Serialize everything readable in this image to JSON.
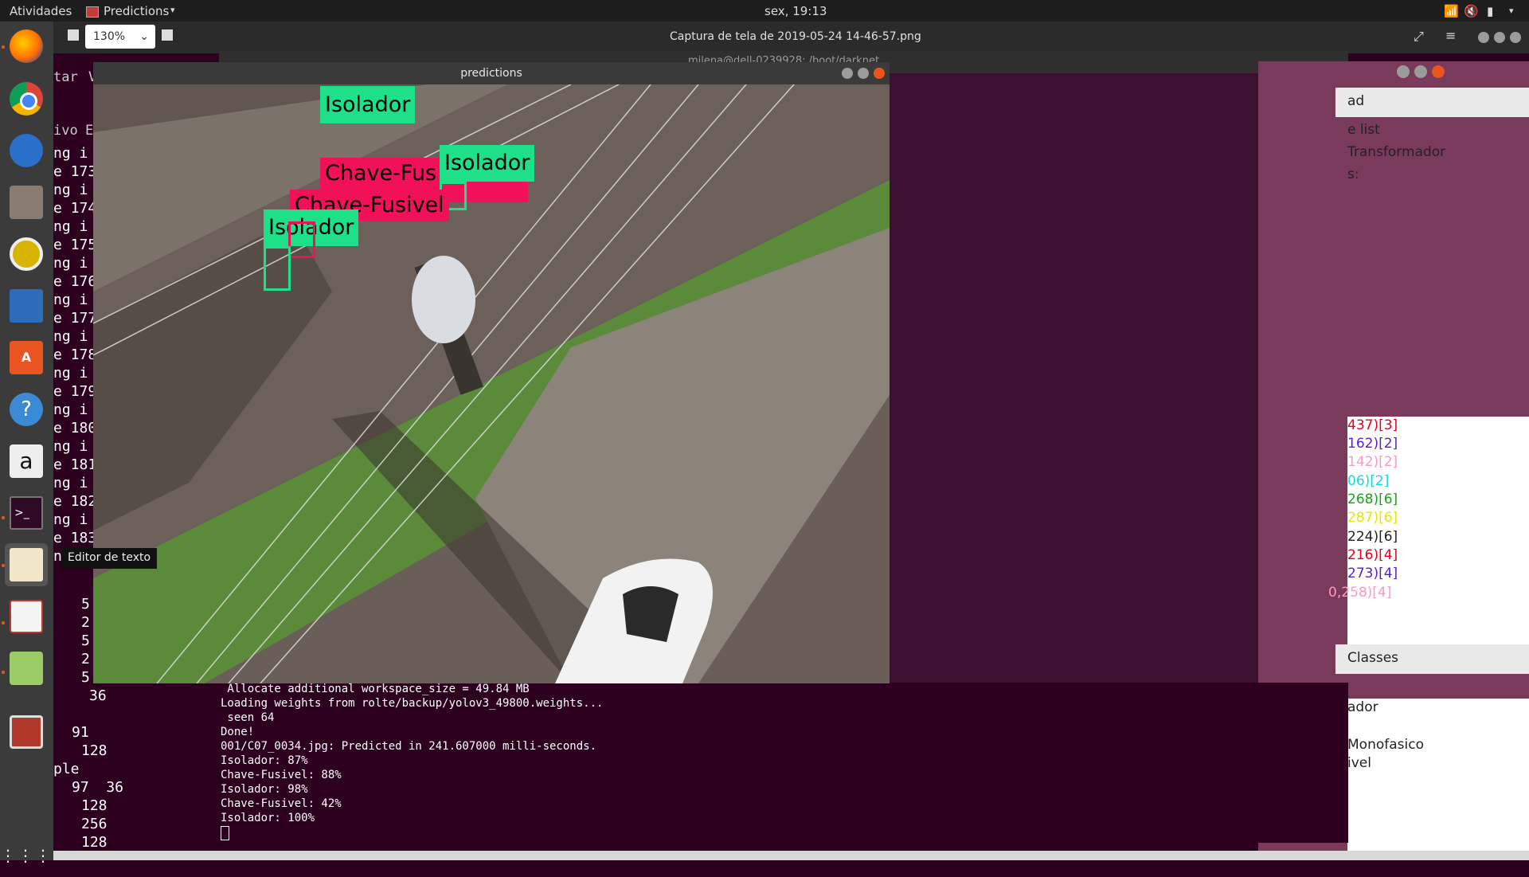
{
  "topbar": {
    "activities": "Atividades",
    "app_menu": "Predictions",
    "clock": "sex, 19:13"
  },
  "viewer": {
    "zoom": "130%",
    "title": "Captura de tela de 2019-05-24 14-46-57.png"
  },
  "background_window": {
    "title": "milena@dell-0239928: /boot/darknet",
    "left_menu_partial": [
      "tar",
      "V",
      "ivo",
      "E"
    ]
  },
  "left_terminal": {
    "lines": [
      "ng i",
      "e 173",
      "ng i",
      "e 174",
      "ng i",
      "e 175",
      "ng i",
      "e 176",
      "ng i",
      "e 177",
      "ng i",
      "e 178",
      "ng i",
      "e 179",
      "ng i",
      "e 180",
      "ng i",
      "e 181",
      "ng i",
      "e 182",
      "ng i",
      "e 183",
      "ng"
    ],
    "numbers": [
      "5",
      "2",
      "5",
      "2",
      "5",
      "36",
      "91",
      "128",
      "ple",
      "97  36",
      "128",
      "256",
      "128"
    ]
  },
  "right_panel": {
    "header": "ad",
    "texts": [
      "e list",
      "Transformador",
      "s:"
    ],
    "classes_header": "Classes",
    "class_items": [
      "ador",
      "Monofasico",
      "ivel"
    ],
    "colored_items": [
      {
        "text": "437)[3]",
        "color": "#e3001b"
      },
      {
        "text": "162)[2]",
        "color": "#5a1cd6"
      },
      {
        "text": "142)[2]",
        "color": "#ff9ab8"
      },
      {
        "text": "06)[2]",
        "color": "#15d6e0"
      },
      {
        "text": "268)[6]",
        "color": "#1aa31a"
      },
      {
        "text": "287)[6]",
        "color": "#e6e600"
      },
      {
        "text": "224)[6]",
        "color": "#222222"
      },
      {
        "text": "216)[4]",
        "color": "#e3001b"
      },
      {
        "text": "273)[4]",
        "color": "#5a1cd6"
      },
      {
        "text": "0,258)[4]",
        "color": "#ff9ab8"
      }
    ]
  },
  "predictions_window": {
    "title": "predictions",
    "detections": [
      {
        "label": "Isolador",
        "color": "#1de089"
      },
      {
        "label": "Chave-Fus",
        "color": "#f0115a"
      },
      {
        "label": "Isolador",
        "color": "#1de089"
      },
      {
        "label": "Chave-Fusivel",
        "color": "#f0115a"
      },
      {
        "label": "Isolador",
        "color": "#1de089"
      }
    ]
  },
  "terminal": {
    "lines": [
      " Allocate additional workspace_size = 49.84 MB",
      "Loading weights from rolte/backup/yolov3_49800.weights...",
      " seen 64",
      "Done!",
      "001/C07_0034.jpg: Predicted in 241.607000 milli-seconds.",
      "Isolador: 87%",
      "Chave-Fusivel: 88%",
      "Isolador: 98%",
      "Chave-Fusivel: 42%",
      "Isolador: 100%"
    ]
  },
  "tooltip": "Editor de texto",
  "launcher_icons": [
    "firefox-icon",
    "chrome-icon",
    "thunderbird-icon",
    "files-icon",
    "rhythmbox-icon",
    "writer-icon",
    "software-icon",
    "help-icon",
    "amazon-icon",
    "terminal-icon",
    "text-editor-icon",
    "evince-icon",
    "image-viewer-icon",
    "removable-icon",
    "app-grid-icon"
  ]
}
